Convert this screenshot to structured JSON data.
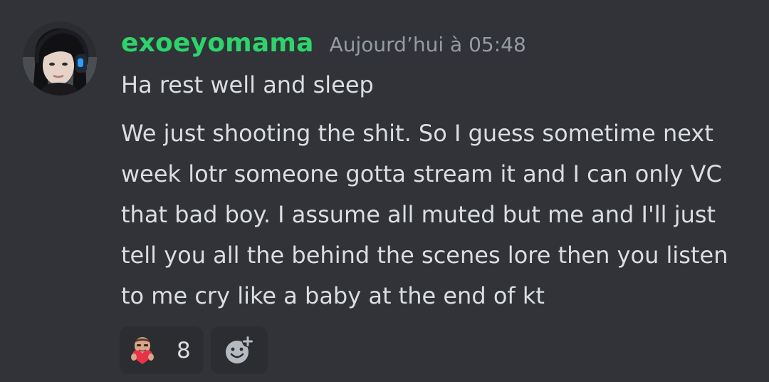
{
  "message": {
    "username": "exoeyomama",
    "timestamp": "Aujourd’hui à 05:48",
    "lines": [
      "Ha rest well and sleep",
      "We just shooting the shit. So I guess sometime next week lotr someone gotta stream it and I can only VC that bad boy. I assume all muted but me and I'll just tell you all the behind the scenes lore then you listen to me cry like a baby at the end of kt"
    ],
    "reactions": [
      {
        "emoji": "custom-heart-emote-icon",
        "count": "8"
      }
    ],
    "add_reaction_icon": "add-reaction-smiley-icon"
  },
  "colors": {
    "background": "#313338",
    "username": "#2dd46b",
    "timestamp": "#949ba4",
    "text": "#dbdee1",
    "reaction_bg": "#2b2d31"
  }
}
